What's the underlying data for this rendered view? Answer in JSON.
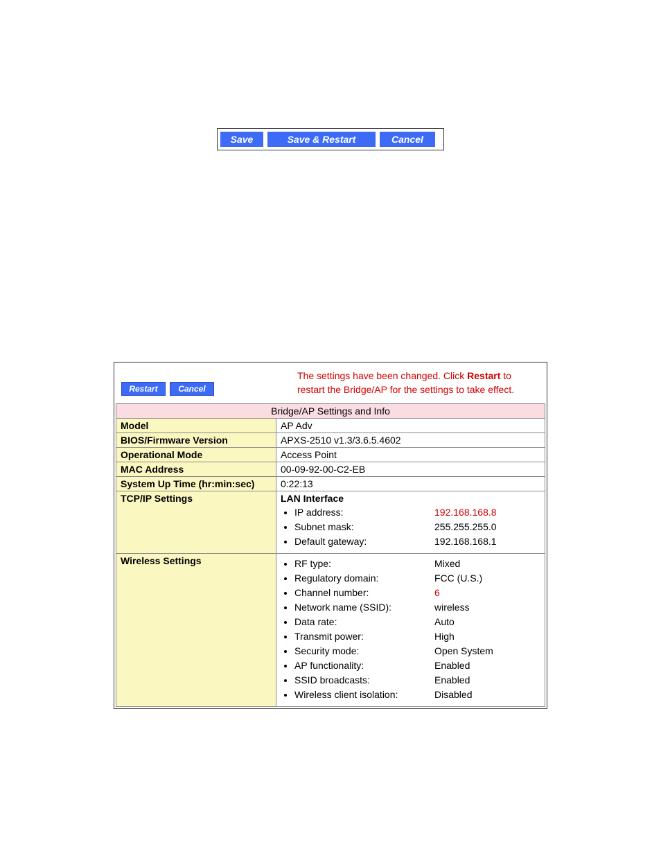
{
  "topButtons": {
    "save": "Save",
    "saveRestart": "Save & Restart",
    "cancel": "Cancel"
  },
  "panel": {
    "buttons": {
      "restart": "Restart",
      "cancel": "Cancel"
    },
    "warning": {
      "pre": "The settings have been changed. Click ",
      "bold": "Restart",
      "post": " to restart the Bridge/AP for the settings to take effect."
    },
    "tableTitle": "Bridge/AP Settings and Info",
    "rows": {
      "model": {
        "label": "Model",
        "value": "AP Adv"
      },
      "bios": {
        "label": "BIOS/Firmware Version",
        "value": "APXS-2510 v1.3/3.6.5.4602"
      },
      "mode": {
        "label": "Operational Mode",
        "value": "Access Point"
      },
      "mac": {
        "label": "MAC Address",
        "value": "00-09-92-00-C2-EB"
      },
      "uptime": {
        "label": "System Up Time (hr:min:sec)",
        "value": "0:22:13"
      },
      "tcpip": {
        "label": "TCP/IP Settings",
        "header": "LAN Interface",
        "items": [
          {
            "label": "IP address:",
            "value": "192.168.168.8",
            "red": true
          },
          {
            "label": "Subnet mask:",
            "value": "255.255.255.0"
          },
          {
            "label": "Default gateway:",
            "value": "192.168.168.1"
          }
        ]
      },
      "wireless": {
        "label": "Wireless Settings",
        "items": [
          {
            "label": "RF type:",
            "value": "Mixed"
          },
          {
            "label": "Regulatory domain:",
            "value": "FCC (U.S.)"
          },
          {
            "label": "Channel number:",
            "value": "6",
            "red": true
          },
          {
            "label": "Network name (SSID):",
            "value": "wireless"
          },
          {
            "label": "Data rate:",
            "value": "Auto"
          },
          {
            "label": "Transmit power:",
            "value": "High"
          },
          {
            "label": "Security mode:",
            "value": "Open System"
          },
          {
            "label": "AP functionality:",
            "value": "Enabled"
          },
          {
            "label": "SSID broadcasts:",
            "value": "Enabled"
          },
          {
            "label": "Wireless client isolation:",
            "value": "Disabled"
          }
        ]
      }
    }
  }
}
